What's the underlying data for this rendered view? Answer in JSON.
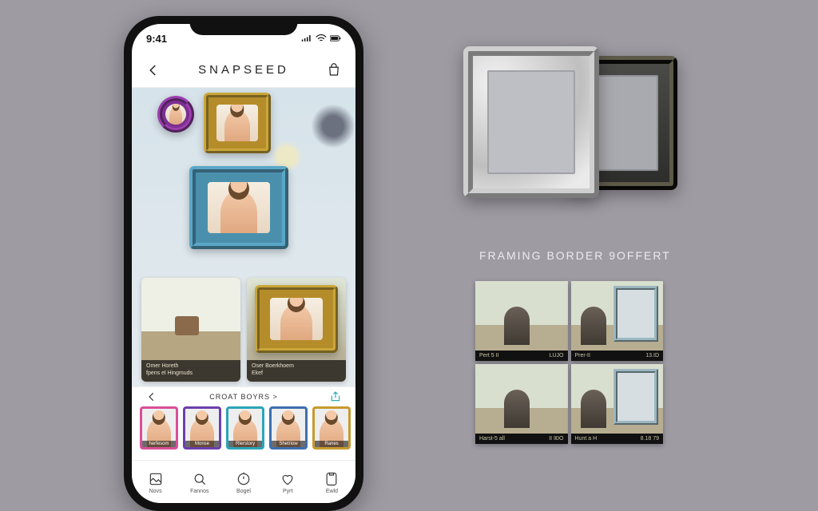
{
  "statusbar": {
    "time": "9:41"
  },
  "nav": {
    "title": "SNAPSEED"
  },
  "canvas": {
    "cards": [
      {
        "title_a": "Omer Horeth",
        "title_b": "fpens el Hingmuds"
      },
      {
        "title_a": "Oser Boerkhoem",
        "title_b": "Ekef"
      }
    ]
  },
  "strip": {
    "header": "CROAT BOYRS  >",
    "thumbs": [
      {
        "label": "herfesom",
        "color": "c-pink"
      },
      {
        "label": "Monse",
        "color": "c-violet"
      },
      {
        "label": "Rlerstory",
        "color": "c-cyan"
      },
      {
        "label": "Shetriow",
        "color": "c-blue"
      },
      {
        "label": "Ranes",
        "color": "c-gold"
      }
    ]
  },
  "tabs": [
    {
      "label": "Novs"
    },
    {
      "label": "Fannos"
    },
    {
      "label": "Bogel"
    },
    {
      "label": "Pyrt"
    },
    {
      "label": "Ewld"
    }
  ],
  "hero_caption": "FRAMING BORDER 9OFFERT",
  "samples": [
    {
      "left": "Pert 5 II",
      "right": "LUJO"
    },
    {
      "left": "Prer-II",
      "right": "13.ID"
    },
    {
      "left": "Harst-5 all",
      "right": "II IÐO"
    },
    {
      "left": "Hunt a H",
      "right": "8.18 79"
    }
  ]
}
